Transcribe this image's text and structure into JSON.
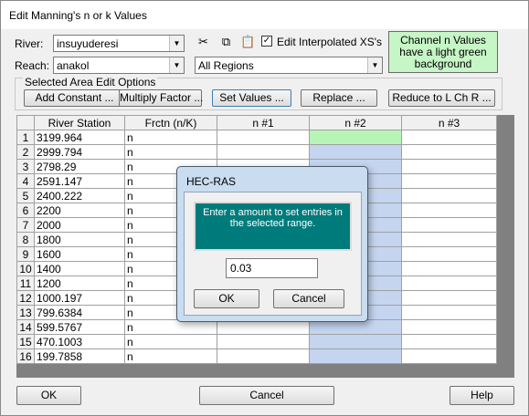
{
  "window": {
    "title": "Edit Manning's n or k Values"
  },
  "river": {
    "label": "River:",
    "value": "insuyuderesi"
  },
  "reach": {
    "label": "Reach:",
    "value": "anakol"
  },
  "regions": {
    "value": "All Regions"
  },
  "toolbar": {
    "cut_icon": "scissors-icon",
    "copy_icon": "copy-icon",
    "paste_icon": "paste-icon"
  },
  "edit_interpolated": {
    "label": "Edit Interpolated XS's",
    "checked": true
  },
  "note": {
    "text": "Channel n Values have a light green background",
    "color": "#c6f5c6"
  },
  "group": {
    "title": "Selected Area Edit Options",
    "buttons": [
      "Add Constant ...",
      "Multiply Factor ...",
      "Set Values ...",
      "Replace ...",
      "Reduce to L Ch R ..."
    ]
  },
  "table": {
    "headers": [
      "River Station",
      "Frctn (n/K)",
      "n #1",
      "n #2",
      "n #3"
    ],
    "rows": [
      {
        "num": "1",
        "station": "3199.964",
        "frctn": "n"
      },
      {
        "num": "2",
        "station": "2999.794",
        "frctn": "n"
      },
      {
        "num": "3",
        "station": "2798.29",
        "frctn": "n"
      },
      {
        "num": "4",
        "station": "2591.147",
        "frctn": "n"
      },
      {
        "num": "5",
        "station": "2400.222",
        "frctn": "n"
      },
      {
        "num": "6",
        "station": "2200",
        "frctn": "n"
      },
      {
        "num": "7",
        "station": "2000",
        "frctn": "n"
      },
      {
        "num": "8",
        "station": "1800",
        "frctn": "n"
      },
      {
        "num": "9",
        "station": "1600",
        "frctn": "n"
      },
      {
        "num": "10",
        "station": "1400",
        "frctn": "n"
      },
      {
        "num": "11",
        "station": "1200",
        "frctn": "n"
      },
      {
        "num": "12",
        "station": "1000.197",
        "frctn": "n"
      },
      {
        "num": "13",
        "station": "799.6384",
        "frctn": "n"
      },
      {
        "num": "14",
        "station": "599.5767",
        "frctn": "n"
      },
      {
        "num": "15",
        "station": "470.1003",
        "frctn": "n"
      },
      {
        "num": "16",
        "station": "199.7858",
        "frctn": "n"
      }
    ]
  },
  "footer": {
    "ok": "OK",
    "cancel": "Cancel",
    "help": "Help"
  },
  "dialog": {
    "title": "HEC-RAS",
    "message": "Enter a amount to set entries in the selected range.",
    "value": "0.03",
    "ok": "OK",
    "cancel": "Cancel"
  }
}
